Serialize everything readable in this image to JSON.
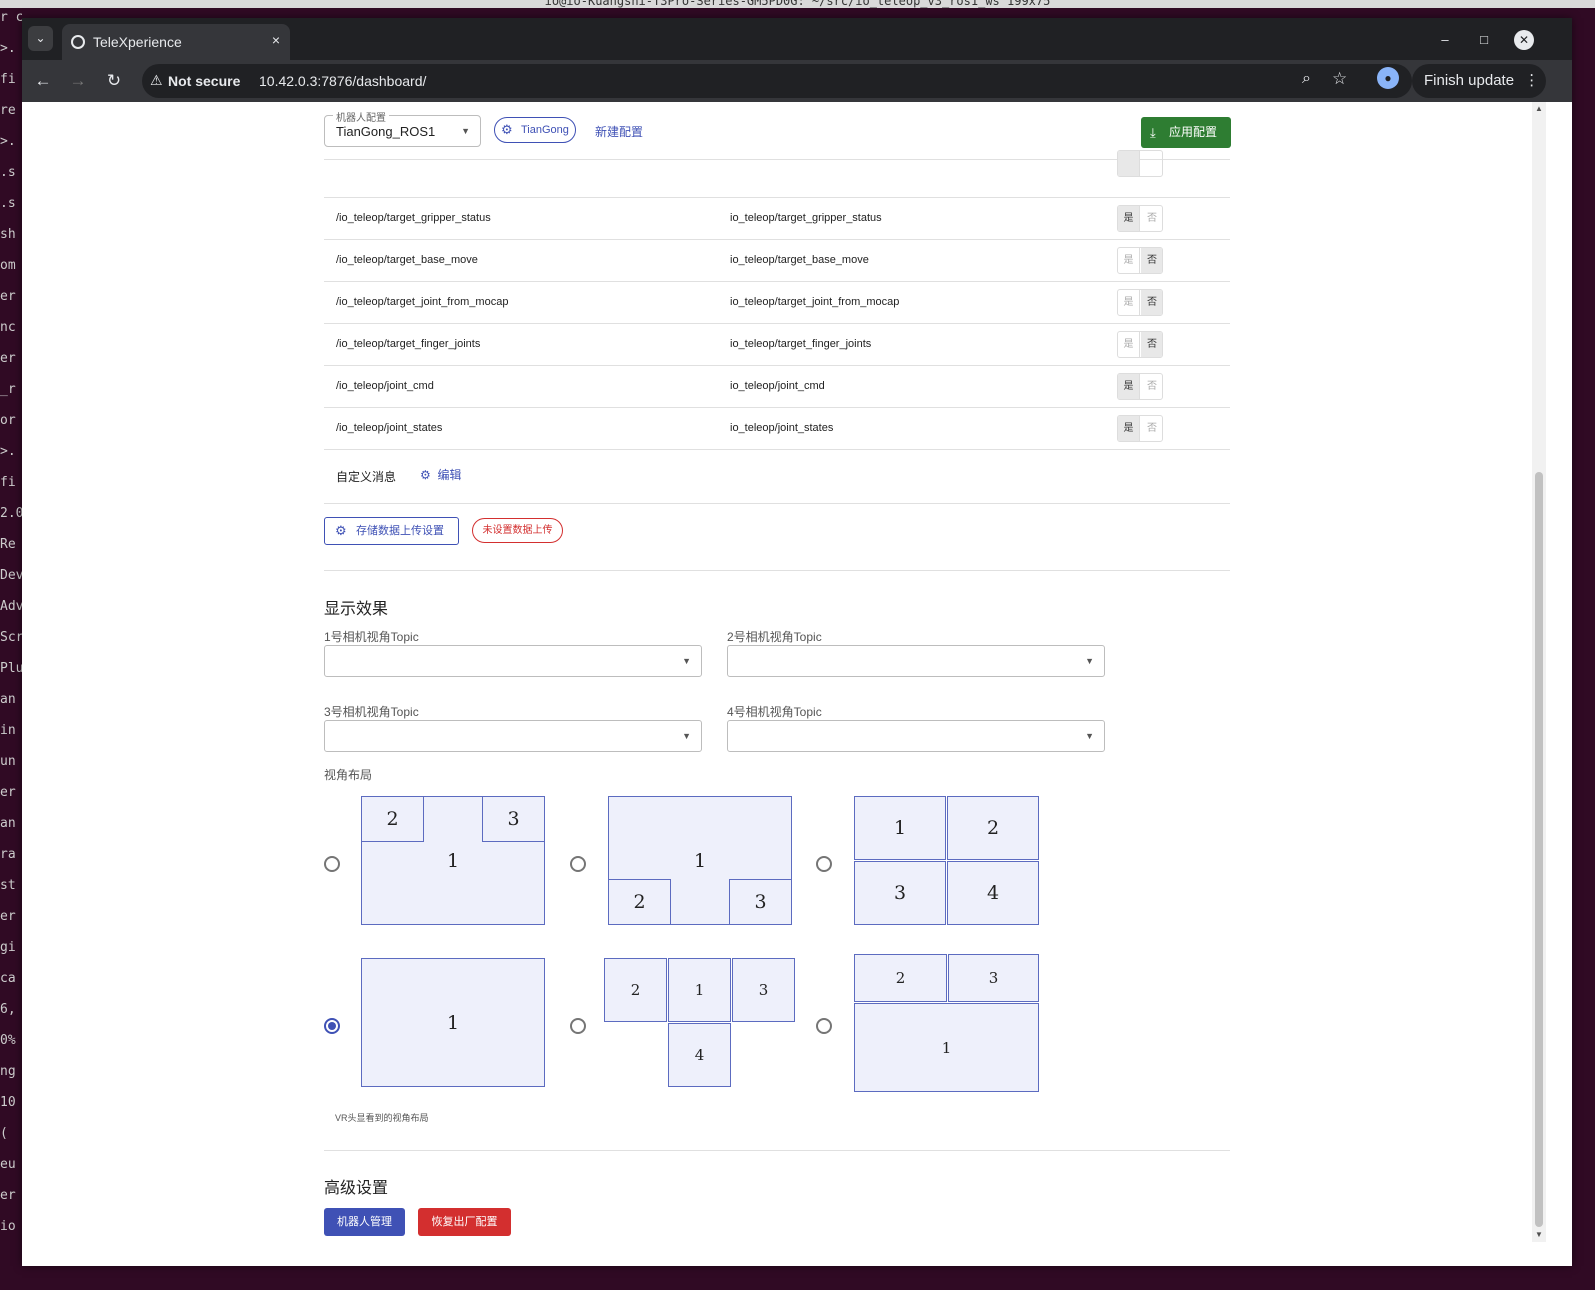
{
  "terminal": {
    "title": "io@io-Kuangshi-T3Pro-Series-GM5PD0G: ~/src/io_teleop_v3_ros1_ws 199x75",
    "side_fragments": [
      "r commit:",
      ">.",
      "fi",
      "re",
      ">.",
      ".s",
      ".s",
      "sh",
      "om",
      "er",
      "nc",
      "er",
      "_r",
      "or",
      ">.",
      "fi",
      "2.0",
      "Re",
      "Dev",
      "Adv",
      "Scr",
      "Plu",
      "an",
      "in",
      "un",
      "er",
      "an",
      "ra",
      "st",
      "er",
      "gi",
      "ca",
      "6,",
      "0%",
      "ng",
      "10",
      "(",
      "eu",
      "er",
      "io"
    ]
  },
  "browser": {
    "tab_title": "TeleXperience",
    "close_glyph": "×",
    "security_label": "Not secure",
    "url": "10.42.0.3:7876/dashboard/",
    "finish_update_label": "Finish update",
    "more_glyph": "⋮"
  },
  "header": {
    "robot_select_label": "机器人配置",
    "robot_select_value": "TianGong_ROS1",
    "robot_chip_label": "TianGong",
    "new_config_label": "新建配置",
    "apply_label": "应用配置"
  },
  "topics": {
    "yes_label": "是",
    "no_label": "否",
    "rows": [
      {
        "source": "/io_teleop/target_gripper_status",
        "target": "io_teleop/target_gripper_status",
        "selected": "yes"
      },
      {
        "source": "/io_teleop/target_base_move",
        "target": "io_teleop/target_base_move",
        "selected": "no"
      },
      {
        "source": "/io_teleop/target_joint_from_mocap",
        "target": "io_teleop/target_joint_from_mocap",
        "selected": "no"
      },
      {
        "source": "/io_teleop/target_finger_joints",
        "target": "io_teleop/target_finger_joints",
        "selected": "no"
      },
      {
        "source": "/io_teleop/joint_cmd",
        "target": "io_teleop/joint_cmd",
        "selected": "yes"
      },
      {
        "source": "/io_teleop/joint_states",
        "target": "io_teleop/joint_states",
        "selected": "yes"
      }
    ],
    "custom_label": "自定义消息",
    "edit_label": "编辑"
  },
  "storage": {
    "button_label": "存储数据上传设置",
    "status_label": "未设置数据上传"
  },
  "display": {
    "title": "显示效果",
    "cam1_label": "1号相机视角Topic",
    "cam2_label": "2号相机视角Topic",
    "cam3_label": "3号相机视角Topic",
    "cam4_label": "4号相机视角Topic",
    "layout_label": "视角布局",
    "selected_layout": 4,
    "vr_hint": "VR头显看到的视角布局"
  },
  "advanced": {
    "title": "高级设置",
    "robot_mgmt_label": "机器人管理",
    "factory_reset_label": "恢复出厂配置"
  },
  "colors": {
    "primary": "#3f51b5",
    "success": "#2e7d32",
    "danger": "#d32f2f",
    "layout_fill": "#eef0fb"
  }
}
